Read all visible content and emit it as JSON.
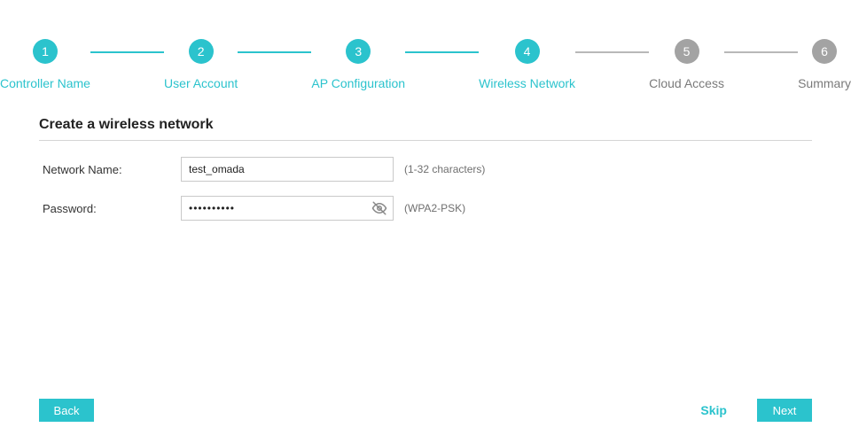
{
  "colors": {
    "accent": "#2bc3cd",
    "muted": "#a3a3a3"
  },
  "stepper": {
    "current": 4,
    "steps": [
      {
        "num": "1",
        "label": "Controller Name",
        "state": "done"
      },
      {
        "num": "2",
        "label": "User Account",
        "state": "done"
      },
      {
        "num": "3",
        "label": "AP Configuration",
        "state": "done"
      },
      {
        "num": "4",
        "label": "Wireless Network",
        "state": "current"
      },
      {
        "num": "5",
        "label": "Cloud Access",
        "state": "upcoming"
      },
      {
        "num": "6",
        "label": "Summary",
        "state": "upcoming"
      }
    ]
  },
  "section": {
    "title": "Create a wireless network"
  },
  "form": {
    "network_name": {
      "label": "Network Name:",
      "value": "test_omada",
      "hint": "(1-32 characters)"
    },
    "password": {
      "label": "Password:",
      "value": "••••••••••",
      "hint": "(WPA2-PSK)",
      "eye_icon": "eye-off-icon"
    }
  },
  "footer": {
    "back": "Back",
    "skip": "Skip",
    "next": "Next"
  }
}
